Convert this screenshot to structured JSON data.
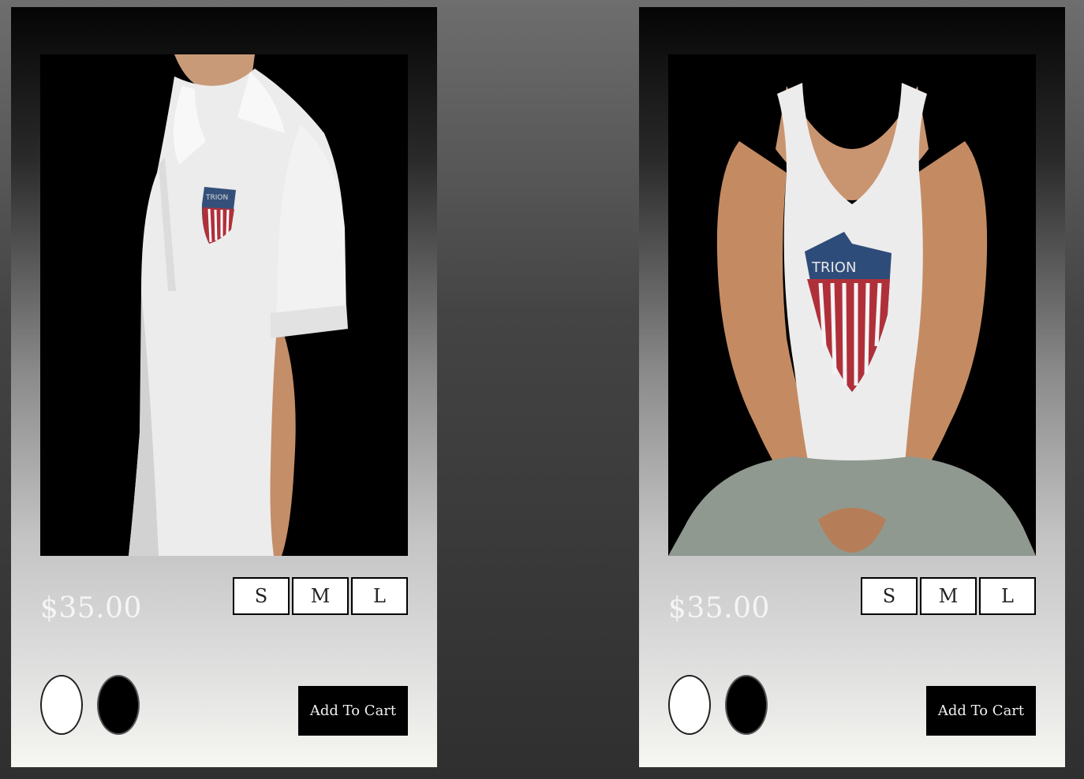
{
  "products": [
    {
      "image_alt": "white-polo-shirt",
      "price": "$35.00",
      "sizes": [
        "S",
        "M",
        "L"
      ],
      "colors": [
        "white",
        "black"
      ],
      "add_to_cart_label": "Add To Cart"
    },
    {
      "image_alt": "white-tank-top",
      "price": "$35.00",
      "sizes": [
        "S",
        "M",
        "L"
      ],
      "colors": [
        "white",
        "black"
      ],
      "add_to_cart_label": "Add To Cart"
    }
  ],
  "colors": {
    "card_top": "#050505",
    "card_bottom": "#f6f6f2",
    "button_bg": "#000000",
    "swatch_white": "#ffffff",
    "swatch_black": "#000000"
  }
}
